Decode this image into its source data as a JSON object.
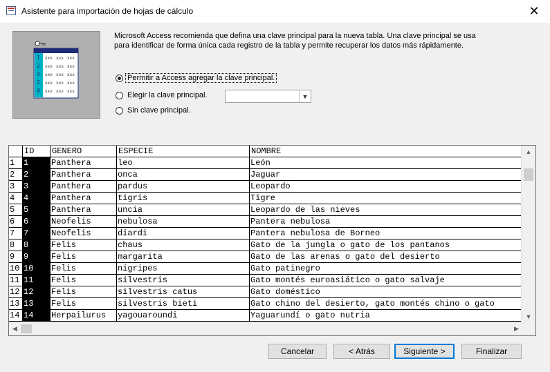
{
  "window": {
    "title": "Asistente para importación de hojas de cálculo",
    "close_glyph": "✕"
  },
  "description": "Microsoft Access recomienda que defina una clave principal para la nueva tabla. Una clave principal se usa para identificar de forma única cada registro de la tabla y permite recuperar los datos más rápidamente.",
  "options": [
    {
      "label": "Permitir a Access agregar la clave principal.",
      "selected": true
    },
    {
      "label": "Elegir la clave principal.",
      "selected": false
    },
    {
      "label": "Sin clave principal.",
      "selected": false
    }
  ],
  "key_field_combo": {
    "value": ""
  },
  "illustration": {
    "row_numbers": [
      "1",
      "2",
      "3",
      "2",
      "4"
    ],
    "cell_text": "xxx"
  },
  "grid": {
    "columns": [
      "ID",
      "GENERO",
      "ESPECIE",
      "NOMBRE"
    ],
    "rows": [
      [
        "1",
        "1",
        "Panthera",
        "leo",
        "León"
      ],
      [
        "2",
        "2",
        "Panthera",
        "onca",
        "Jaguar"
      ],
      [
        "3",
        "3",
        "Panthera",
        "pardus",
        "Leopardo"
      ],
      [
        "4",
        "4",
        "Panthera",
        "tigris",
        "Tigre"
      ],
      [
        "5",
        "5",
        "Panthera",
        "uncia",
        "Leopardo de las nieves"
      ],
      [
        "6",
        "6",
        "Neofelis",
        "nebulosa",
        "Pantera nebulosa"
      ],
      [
        "7",
        "7",
        "Neofelis",
        "diardi",
        "Pantera nebulosa de Borneo"
      ],
      [
        "8",
        "8",
        "Felis",
        "chaus",
        "Gato de la jungla o gato de los pantanos"
      ],
      [
        "9",
        "9",
        "Felis",
        "margarita",
        "Gato de las arenas o gato del desierto"
      ],
      [
        "10",
        "10",
        "Felis",
        "nigripes",
        "Gato patinegro"
      ],
      [
        "11",
        "11",
        "Felis",
        "silvestris",
        "Gato montés euroasiático o gato salvaje"
      ],
      [
        "12",
        "12",
        "Felis",
        "silvestris catus",
        "Gato doméstico"
      ],
      [
        "13",
        "13",
        "Felis",
        "silvestris bieti",
        "Gato chino del desierto, gato montés chino o gato"
      ],
      [
        "14",
        "14",
        "Herpailurus",
        "yagouaroundi",
        "Yaguarundí o gato nutria"
      ]
    ]
  },
  "buttons": {
    "cancel": "Cancelar",
    "back": "< Atrás",
    "next": "Siguiente >",
    "finish": "Finalizar"
  },
  "colors": {
    "accent": "#0078d7",
    "id_column_bg": "#000000",
    "illustration_teal": "#00b2c6",
    "illustration_navy": "#1f2a78"
  }
}
